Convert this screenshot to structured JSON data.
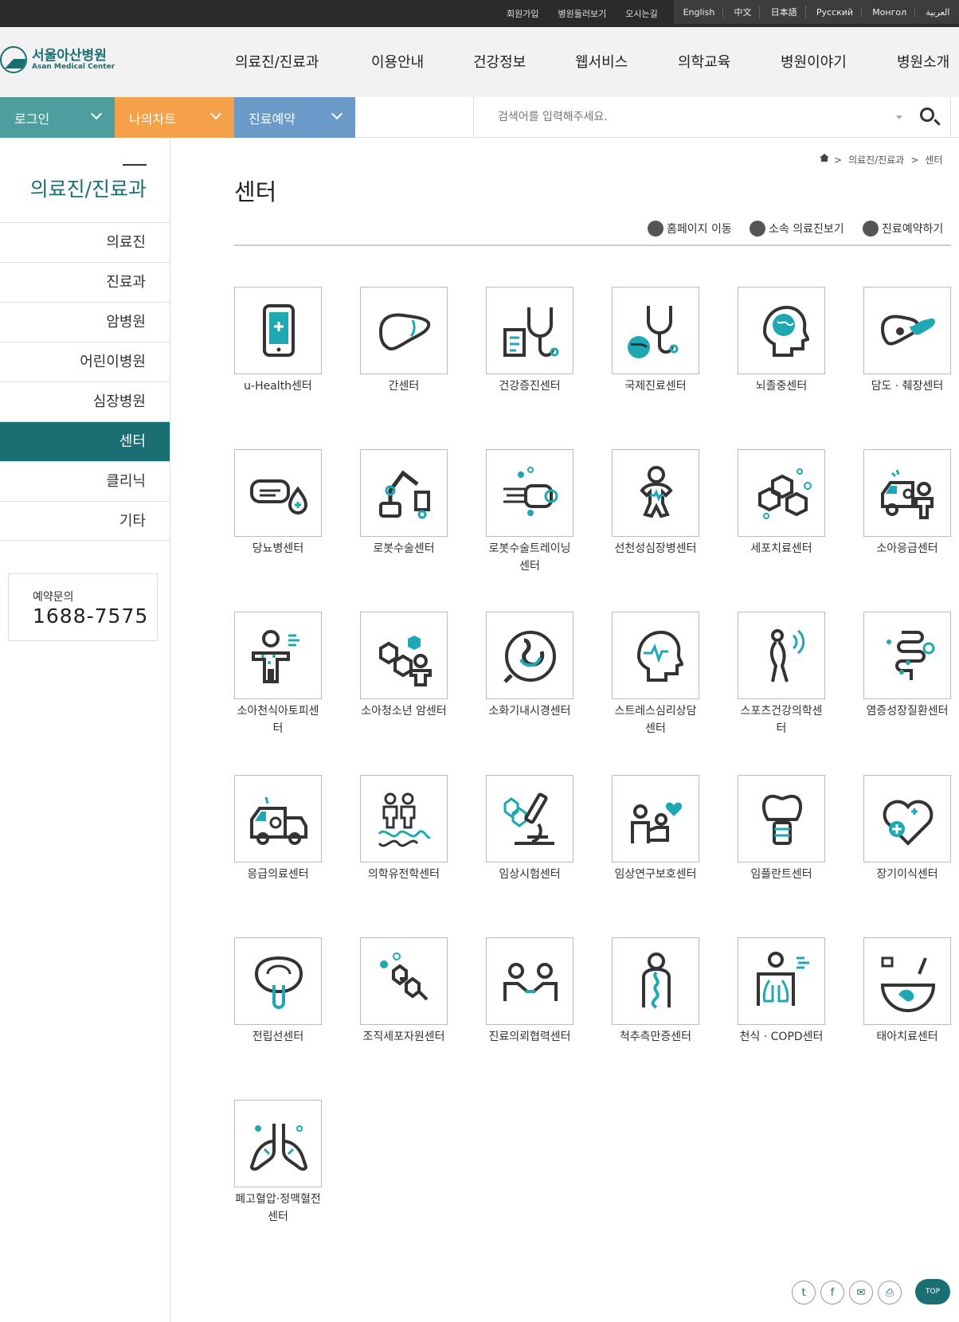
{
  "util_links": [
    "회원가입",
    "병원둘러보기",
    "오시는길"
  ],
  "languages": [
    "English",
    "中文",
    "日本語",
    "Русский",
    "Монгол",
    "العربية"
  ],
  "logo": {
    "ko": "서울아산병원",
    "en": "Asan Medical Center"
  },
  "gnb": [
    "의료진/진료과",
    "이용안내",
    "건강정보",
    "웹서비스",
    "의학교육",
    "병원이야기",
    "병원소개"
  ],
  "quick": {
    "login": "로그인",
    "mychart": "나의차트",
    "reserve": "진료예약"
  },
  "search": {
    "placeholder": "검색어를 입력해주세요."
  },
  "lnb": {
    "title": "의료진/진료과",
    "items": [
      "의료진",
      "진료과",
      "암병원",
      "어린이병원",
      "심장병원",
      "센터",
      "클리닉",
      "기타"
    ],
    "active": "센터"
  },
  "call": {
    "label": "예약문의",
    "number": "1688-7575"
  },
  "breadcrumb": [
    "의료진/진료과",
    "센터"
  ],
  "page_title": "센터",
  "tools": [
    "홈페이지 이동",
    "소속 의료진보기",
    "진료예약하기"
  ],
  "centers": [
    "u-Health센터",
    "간센터",
    "건강증진센터",
    "국제진료센터",
    "뇌졸중센터",
    "담도 · 췌장센터",
    "당뇨병센터",
    "로봇수술센터",
    "로봇수술트레이닝\n센터",
    "선천성심장병센터",
    "세포치료센터",
    "소아응급센터",
    "소아천식아토피센\n터",
    "소아청소년 암센터",
    "소화기내시경센터",
    "스트레스심리상담\n센터",
    "스포츠건강의학센\n터",
    "염증성장질환센터",
    "응급의료센터",
    "의학유전학센터",
    "임상시험센터",
    "임상연구보호센터",
    "임플란트센터",
    "장기이식센터",
    "전립선센터",
    "조직세포자원센터",
    "진료의뢰협력센터",
    "척추측만증센터",
    "천식 · COPD센터",
    "태아치료센터",
    "폐고혈압·정맥혈전\n센터"
  ],
  "share": [
    "twitter-icon",
    "facebook-icon",
    "mail-icon",
    "print-icon"
  ],
  "top_label": "TOP",
  "colors": {
    "teal": "#1a6f73",
    "quick_login": "#4e9e9d",
    "quick_mychart": "#f4a14a",
    "quick_reserve": "#6a9ac8",
    "accent": "#1ea8b4"
  }
}
